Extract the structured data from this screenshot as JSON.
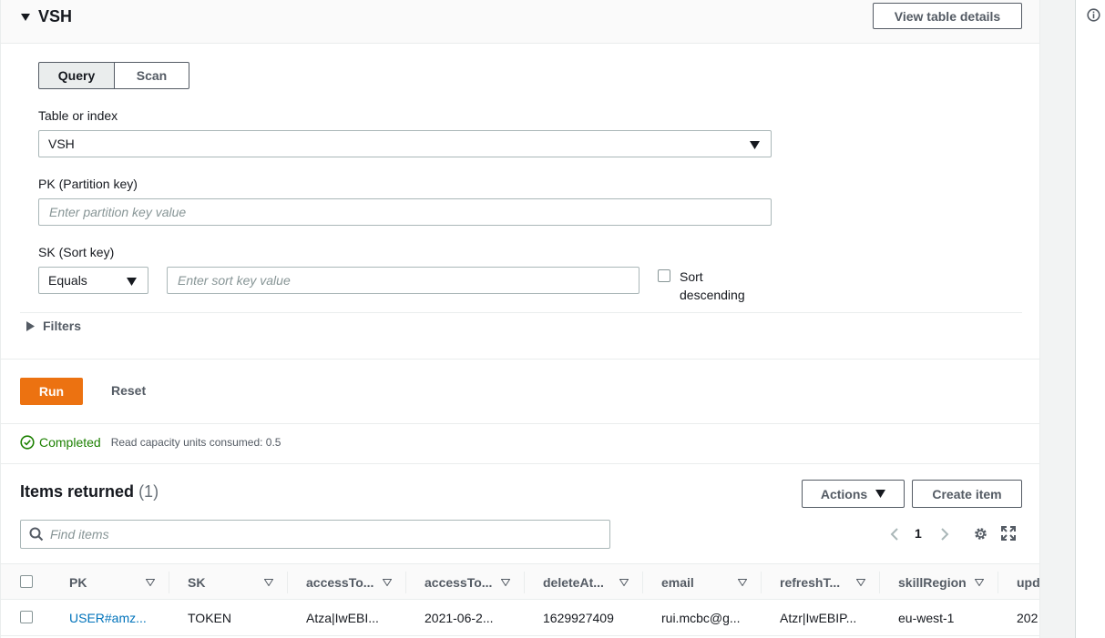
{
  "panel": {
    "title": "VSH",
    "view_details_label": "View table details"
  },
  "mode": {
    "query_label": "Query",
    "scan_label": "Scan",
    "selected": "Query"
  },
  "form": {
    "table_label": "Table or index",
    "table_value": "VSH",
    "pk_label": "PK (Partition key)",
    "pk_placeholder": "Enter partition key value",
    "sk_label": "SK (Sort key)",
    "sk_operator": "Equals",
    "sk_placeholder": "Enter sort key value",
    "sort_desc_line1": "Sort",
    "sort_desc_line2": "descending",
    "filters_label": "Filters"
  },
  "actions": {
    "run_label": "Run",
    "reset_label": "Reset"
  },
  "status": {
    "text": "Completed",
    "meta": "Read capacity units consumed: 0.5"
  },
  "items": {
    "title": "Items returned",
    "count": "(1)",
    "actions_label": "Actions",
    "create_label": "Create item",
    "find_placeholder": "Find items",
    "page": "1",
    "columns": [
      "PK",
      "SK",
      "accessTo...",
      "accessTo...",
      "deleteAt...",
      "email",
      "refreshT...",
      "skillRegion",
      "upd"
    ],
    "rows": [
      [
        "USER#amz...",
        "TOKEN",
        "Atza|IwEBI...",
        "2021-06-2...",
        "1629927409",
        "rui.mcbc@g...",
        "Atzr|IwEBIP...",
        "eu-west-1",
        "202"
      ]
    ]
  },
  "colors": {
    "accent": "#ec7211",
    "link": "#0073bb",
    "success": "#1d8102",
    "text": "#16191f",
    "muted": "#545b64"
  },
  "icons": [
    "caret-down-icon",
    "caret-right-icon",
    "info-icon",
    "check-circle-icon",
    "search-icon",
    "chevron-left-icon",
    "chevron-right-icon",
    "gear-icon",
    "fullscreen-icon",
    "sort-caret-icon"
  ]
}
